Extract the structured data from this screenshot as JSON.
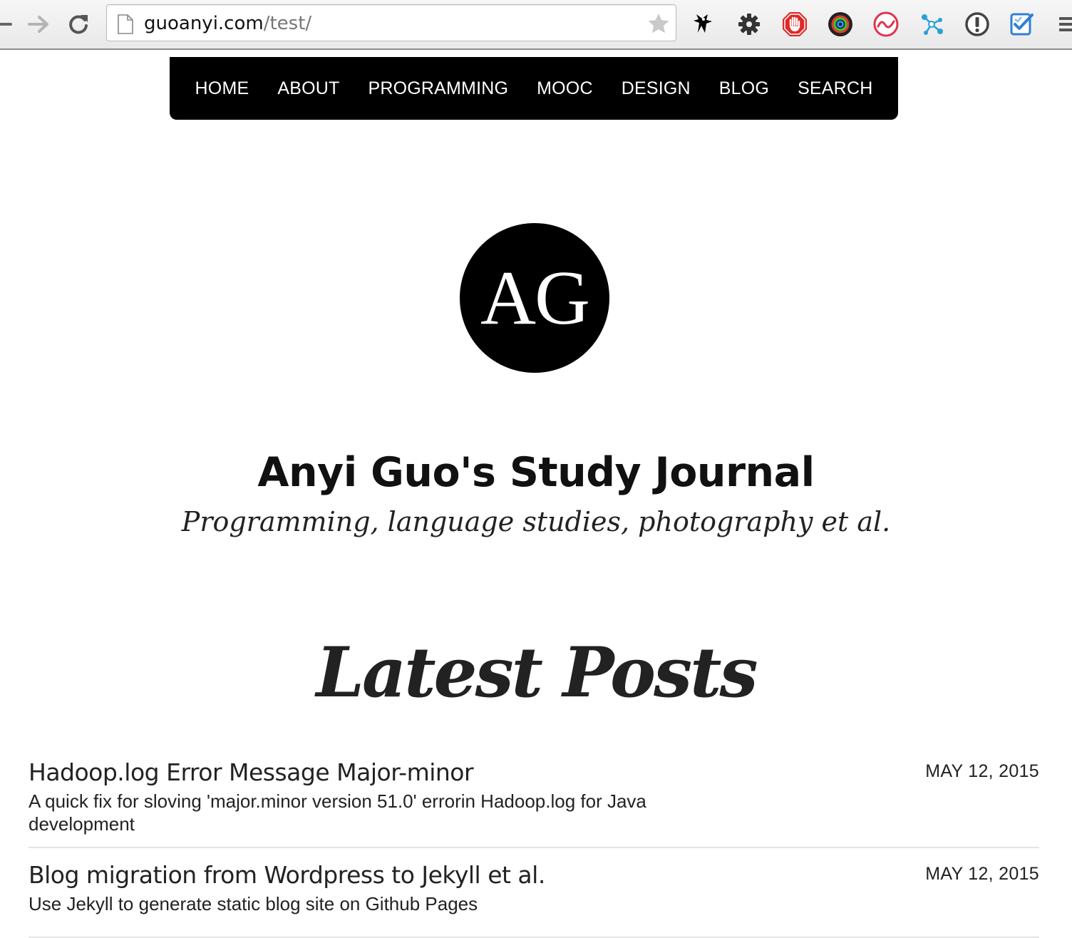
{
  "browser": {
    "url_host": "guoanyi.com",
    "url_path": "/test/",
    "extensions": [
      "ninja-icon",
      "gear-icon",
      "adblock-icon",
      "colorpick-icon",
      "wave-icon",
      "network-icon",
      "info-icon",
      "checklist-icon"
    ]
  },
  "nav": {
    "items": [
      "HOME",
      "ABOUT",
      "PROGRAMMING",
      "MOOC",
      "DESIGN",
      "BLOG",
      "SEARCH"
    ]
  },
  "hero": {
    "logo_text": "AG",
    "title": "Anyi Guo's Study Journal",
    "subtitle": "Programming, language studies, photography et al."
  },
  "posts_section": {
    "heading": "Latest Posts",
    "posts": [
      {
        "title": "Hadoop.log Error Message Major-minor",
        "excerpt": "A quick fix for sloving 'major.minor version 51.0' errorin Hadoop.log for Java development",
        "date": "MAY 12, 2015"
      },
      {
        "title": "Blog migration from Wordpress to Jekyll et al.",
        "excerpt": "Use Jekyll to generate static blog site on Github Pages",
        "date": "MAY 12, 2015"
      }
    ]
  }
}
